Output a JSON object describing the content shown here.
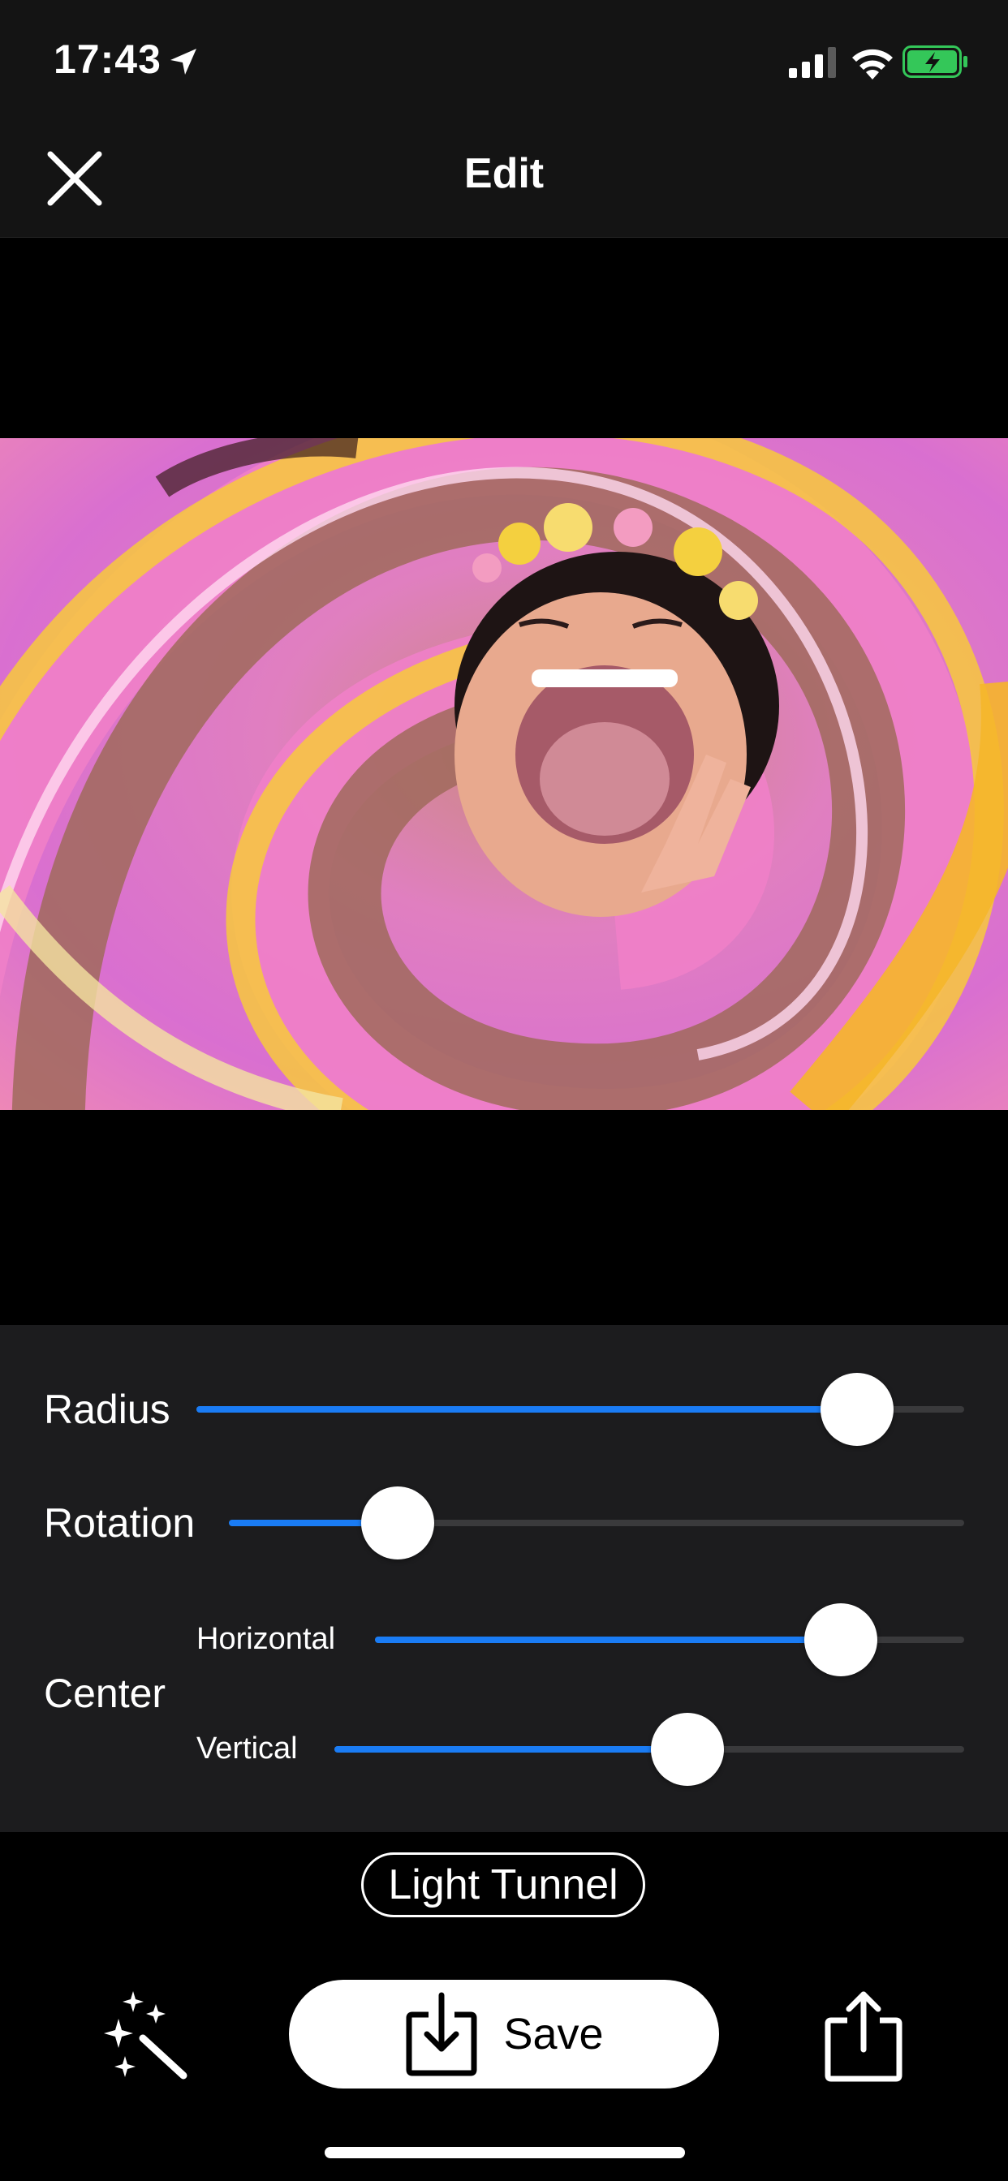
{
  "status_bar": {
    "time": "17:43",
    "icons": [
      "location-arrow-icon",
      "cellular-signal-icon",
      "wifi-icon",
      "battery-charging-icon"
    ]
  },
  "nav": {
    "title": "Edit",
    "close_icon": "close-icon"
  },
  "photo": {
    "description_icon": "swirl-photo"
  },
  "controls": {
    "radius": {
      "label": "Radius",
      "value": 0.86
    },
    "rotation": {
      "label": "Rotation",
      "value": 0.23
    },
    "center": {
      "label": "Center",
      "horizontal": {
        "label": "Horizontal",
        "value": 0.79
      },
      "vertical": {
        "label": "Vertical",
        "value": 0.56
      }
    }
  },
  "filter": {
    "name": "Light Tunnel"
  },
  "toolbar": {
    "magic_icon": "magic-wand-icon",
    "save_label": "Save",
    "save_icon": "download-icon",
    "share_icon": "share-icon"
  },
  "colors": {
    "accent": "#1a7cf5",
    "panel_bg": "#1c1c1e",
    "bar_bg": "#141414",
    "battery_green": "#34c759"
  }
}
